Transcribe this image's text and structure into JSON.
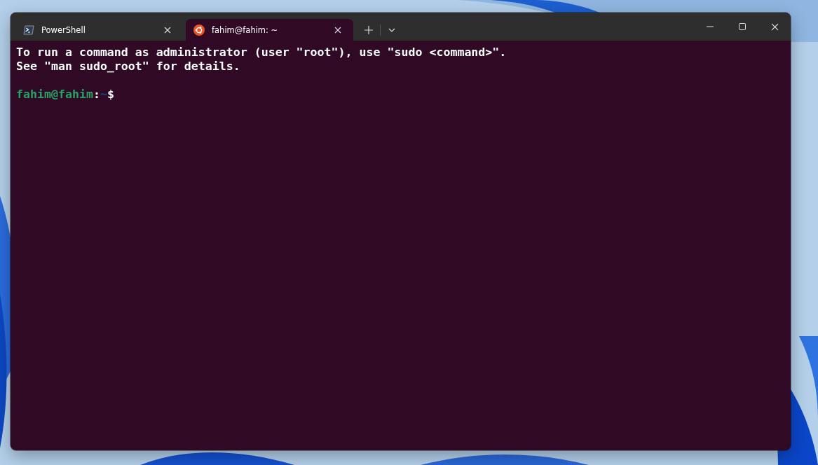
{
  "tabs": [
    {
      "label": "PowerShell",
      "kind": "shell",
      "selected": false
    },
    {
      "label": "fahim@fahim: ~",
      "kind": "linux",
      "selected": true
    }
  ],
  "terminal": {
    "lines": [
      "To run a command as administrator (user \"root\"), use \"sudo <command>\".",
      "See \"man sudo_root\" for details."
    ],
    "prompt": [
      {
        "kind": "user",
        "text": "fahim@fahim"
      },
      {
        "kind": "separator",
        "text": ":"
      },
      {
        "kind": "path",
        "text": "~"
      },
      {
        "kind": "symbol",
        "text": "$"
      }
    ]
  }
}
